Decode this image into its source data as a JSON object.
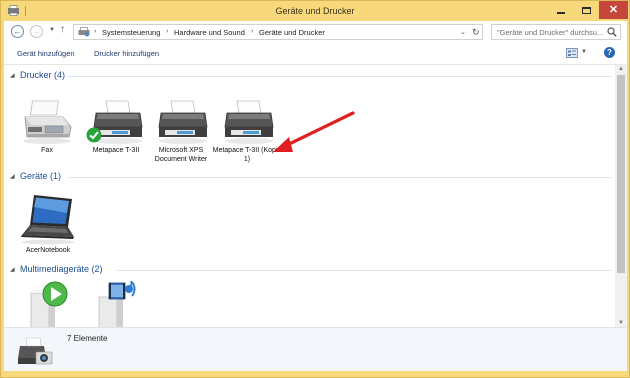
{
  "window": {
    "title": "Geräte und Drucker",
    "controls": {
      "minimize": "minimize-icon",
      "maximize": "maximize-icon",
      "close": "close-icon"
    }
  },
  "address": {
    "breadcrumbs": [
      "Systemsteuerung",
      "Hardware und Sound",
      "Geräte und Drucker"
    ],
    "search_placeholder": "\"Geräte und Drucker\" durchsu..."
  },
  "commands": {
    "add_device": "Gerät hinzufügen",
    "add_printer": "Drucker hinzufügen"
  },
  "groups": {
    "printers": {
      "title": "Drucker (4)",
      "items": [
        {
          "label": "Fax",
          "icon": "fax-icon"
        },
        {
          "label": "Metapace T-3II",
          "icon": "printer-icon",
          "default": true
        },
        {
          "label": "Microsoft XPS Document Writer",
          "icon": "printer-icon"
        },
        {
          "label": "Metapace T-3II (Kopie 1)",
          "icon": "printer-icon"
        }
      ]
    },
    "devices": {
      "title": "Geräte (1)",
      "items": [
        {
          "label": "AcerNotebook",
          "icon": "laptop-icon"
        }
      ]
    },
    "multimedia": {
      "title": "Multimediageräte (2)",
      "items": [
        {
          "label": "",
          "icon": "media-play-device-icon"
        },
        {
          "label": "",
          "icon": "media-server-icon"
        }
      ]
    }
  },
  "details": {
    "count": "7 Elemente"
  },
  "colors": {
    "titlebar": "#f7d97c",
    "close_button": "#c7463b",
    "group_title": "#1e4f96",
    "annotation_arrow": "#e02020",
    "default_check": "#2aa33a"
  }
}
